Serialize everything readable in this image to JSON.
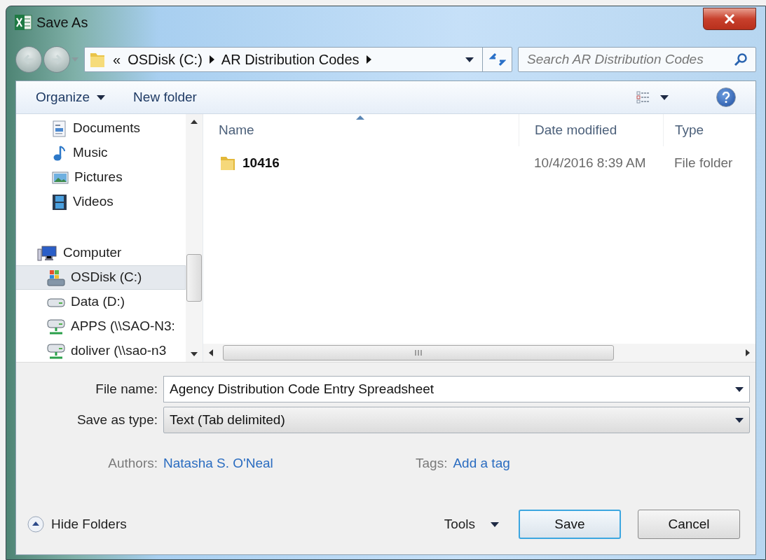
{
  "window": {
    "title": "Save As"
  },
  "address_bar": {
    "overflow": "«",
    "segments": [
      "OSDisk (C:)",
      "AR Distribution Codes"
    ]
  },
  "search": {
    "placeholder": "Search AR Distribution Codes"
  },
  "toolbar": {
    "items": [
      {
        "label": "Organize",
        "has_menu": true
      },
      {
        "label": "New folder",
        "has_menu": false
      }
    ]
  },
  "sidebar": {
    "library_items": [
      {
        "label": "Documents",
        "kind": "documents",
        "selected": false
      },
      {
        "label": "Music",
        "kind": "music",
        "selected": false
      },
      {
        "label": "Pictures",
        "kind": "pictures",
        "selected": false
      },
      {
        "label": "Videos",
        "kind": "videos",
        "selected": false
      }
    ],
    "computer": {
      "label": "Computer",
      "children": [
        {
          "label": "OSDisk (C:)",
          "kind": "system-drive",
          "selected": true
        },
        {
          "label": "Data (D:)",
          "kind": "drive",
          "selected": false
        },
        {
          "label": "APPS (\\\\SAO-N3:",
          "kind": "network-drive",
          "selected": false
        },
        {
          "label": "doliver (\\\\sao-n3",
          "kind": "network-drive",
          "selected": false
        }
      ]
    }
  },
  "table": {
    "columns": [
      "Name",
      "Date modified",
      "Type"
    ],
    "rows": [
      {
        "name": "10416",
        "date_modified": "10/4/2016 8:39 AM",
        "type": "File folder",
        "selected": false
      }
    ]
  },
  "form": {
    "file_name": {
      "label": "File name:",
      "value": "Agency Distribution Code Entry Spreadsheet"
    },
    "save_as_type": {
      "label": "Save as type:",
      "value": "Text (Tab delimited)"
    },
    "authors": {
      "label": "Authors:",
      "value": "Natasha S. O'Neal"
    },
    "tags": {
      "label": "Tags:",
      "value": "Add a tag"
    }
  },
  "footer": {
    "hide_folders": "Hide Folders",
    "tools": "Tools",
    "save": "Save",
    "cancel": "Cancel"
  }
}
